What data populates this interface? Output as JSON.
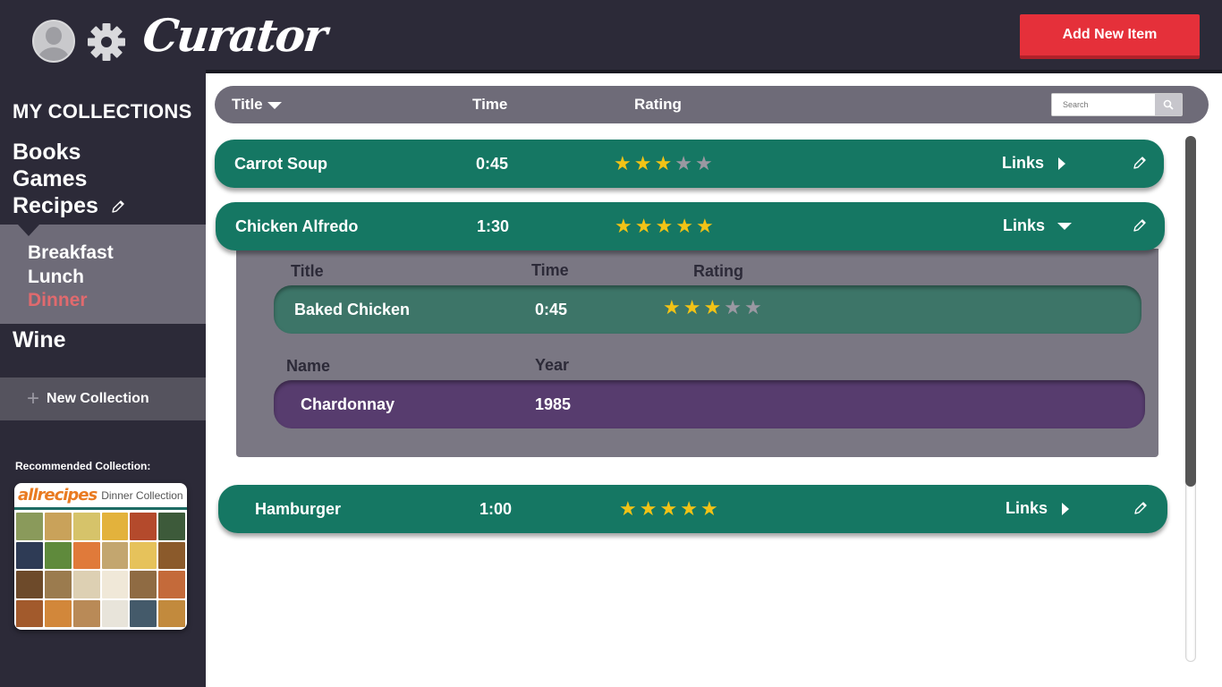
{
  "app": {
    "logo": "Curator",
    "add_button": "Add New Item"
  },
  "sidebar": {
    "heading": "MY COLLECTIONS",
    "collections": [
      "Books",
      "Games",
      "Recipes",
      "Wine"
    ],
    "subcollections": [
      "Breakfast",
      "Lunch",
      "Dinner"
    ],
    "active_subcollection": "Dinner",
    "new_collection": "New Collection",
    "recommended_label": "Recommended Collection:",
    "recommended": {
      "brand": "allrecipes",
      "title": "Dinner Collection"
    }
  },
  "columns": {
    "title": "Title",
    "time": "Time",
    "rating": "Rating"
  },
  "search": {
    "placeholder": "Search"
  },
  "items": [
    {
      "title": "Carrot Soup",
      "time": "0:45",
      "rating": 3,
      "links": "Links",
      "expanded": false
    },
    {
      "title": "Chicken Alfredo",
      "time": "1:30",
      "rating": 5,
      "links": "Links",
      "expanded": true
    },
    {
      "title": "Hamburger",
      "time": "1:00",
      "rating": 5,
      "links": "Links",
      "expanded": false
    }
  ],
  "expanded": {
    "recipe_headers": {
      "title": "Title",
      "time": "Time",
      "rating": "Rating"
    },
    "recipe": {
      "title": "Baked Chicken",
      "time": "0:45",
      "rating": 3
    },
    "wine_headers": {
      "name": "Name",
      "year": "Year"
    },
    "wine": {
      "name": "Chardonnay",
      "year": "1985"
    }
  },
  "colors": {
    "accent": "#e5303a",
    "row_green": "#157763",
    "sub_green": "#3d7568",
    "sub_purple": "#573c6e",
    "star": "#f2c316",
    "active_sub": "#e06a6e"
  }
}
